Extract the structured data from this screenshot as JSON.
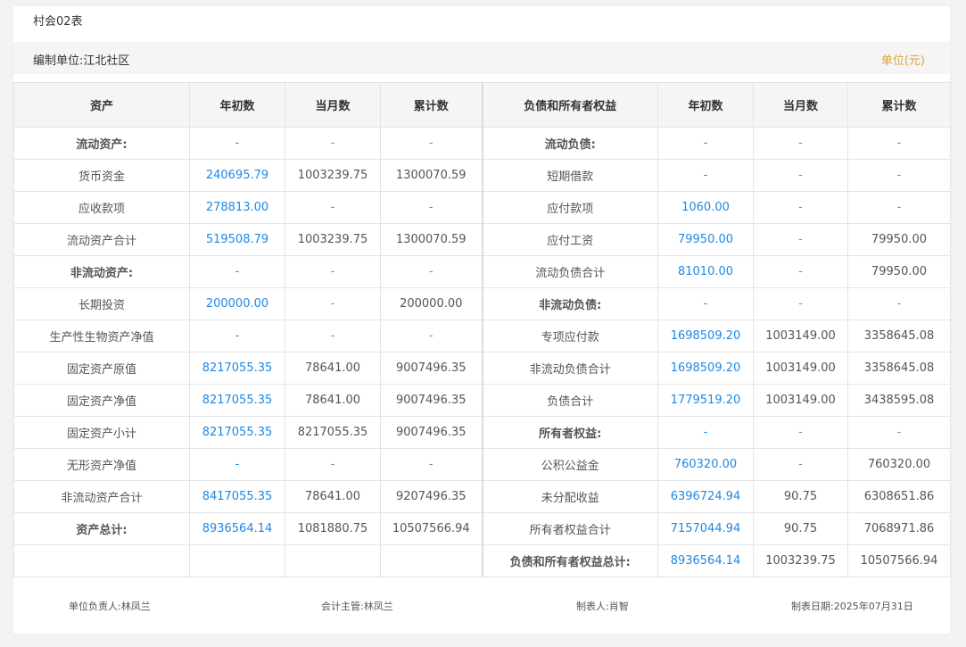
{
  "title": "村会02表",
  "org": {
    "label": "编制单位:江北社区",
    "unit": "单位(元)"
  },
  "headers": [
    "资产",
    "年初数",
    "当月数",
    "累计数",
    "负债和所有者权益",
    "年初数",
    "当月数",
    "累计数"
  ],
  "rows": [
    [
      "流动资产:",
      "-",
      "-",
      "-",
      "流动负债:",
      "-",
      "-",
      "-"
    ],
    [
      "货币资金",
      "240695.79",
      "1003239.75",
      "1300070.59",
      "短期借款",
      "-",
      "-",
      "-"
    ],
    [
      "应收款项",
      "278813.00",
      "-",
      "-",
      "应付款项",
      "1060.00",
      "-",
      "-"
    ],
    [
      "流动资产合计",
      "519508.79",
      "1003239.75",
      "1300070.59",
      "应付工资",
      "79950.00",
      "-",
      "79950.00"
    ],
    [
      "非流动资产:",
      "-",
      "-",
      "-",
      "流动负债合计",
      "81010.00",
      "-",
      "79950.00"
    ],
    [
      "长期投资",
      "200000.00",
      "-",
      "200000.00",
      "非流动负债:",
      "-",
      "-",
      "-"
    ],
    [
      "生产性生物资产净值",
      "-",
      "-",
      "-",
      "专项应付款",
      "1698509.20",
      "1003149.00",
      "3358645.08"
    ],
    [
      "固定资产原值",
      "8217055.35",
      "78641.00",
      "9007496.35",
      "非流动负债合计",
      "1698509.20",
      "1003149.00",
      "3358645.08"
    ],
    [
      "固定资产净值",
      "8217055.35",
      "78641.00",
      "9007496.35",
      "负债合计",
      "1779519.20",
      "1003149.00",
      "3438595.08"
    ],
    [
      "固定资产小计",
      "8217055.35",
      "8217055.35",
      "9007496.35",
      "所有者权益:",
      "-",
      "-",
      "-"
    ],
    [
      "无形资产净值",
      "-",
      "-",
      "-",
      "公积公益金",
      "760320.00",
      "-",
      "760320.00"
    ],
    [
      "非流动资产合计",
      "8417055.35",
      "78641.00",
      "9207496.35",
      "未分配收益",
      "6396724.94",
      "90.75",
      "6308651.86"
    ],
    [
      "资产总计:",
      "8936564.14",
      "1081880.75",
      "10507566.94",
      "所有者权益合计",
      "7157044.94",
      "90.75",
      "7068971.86"
    ],
    [
      "",
      "",
      "",
      "",
      "负债和所有者权益总计:",
      "8936564.14",
      "1003239.75",
      "10507566.94"
    ]
  ],
  "footer": {
    "head": "单位负责人:林凤兰",
    "accountant": "会计主管:林凤兰",
    "preparer": "制表人:肖智",
    "date": "制表日期:2025年07月31日"
  }
}
